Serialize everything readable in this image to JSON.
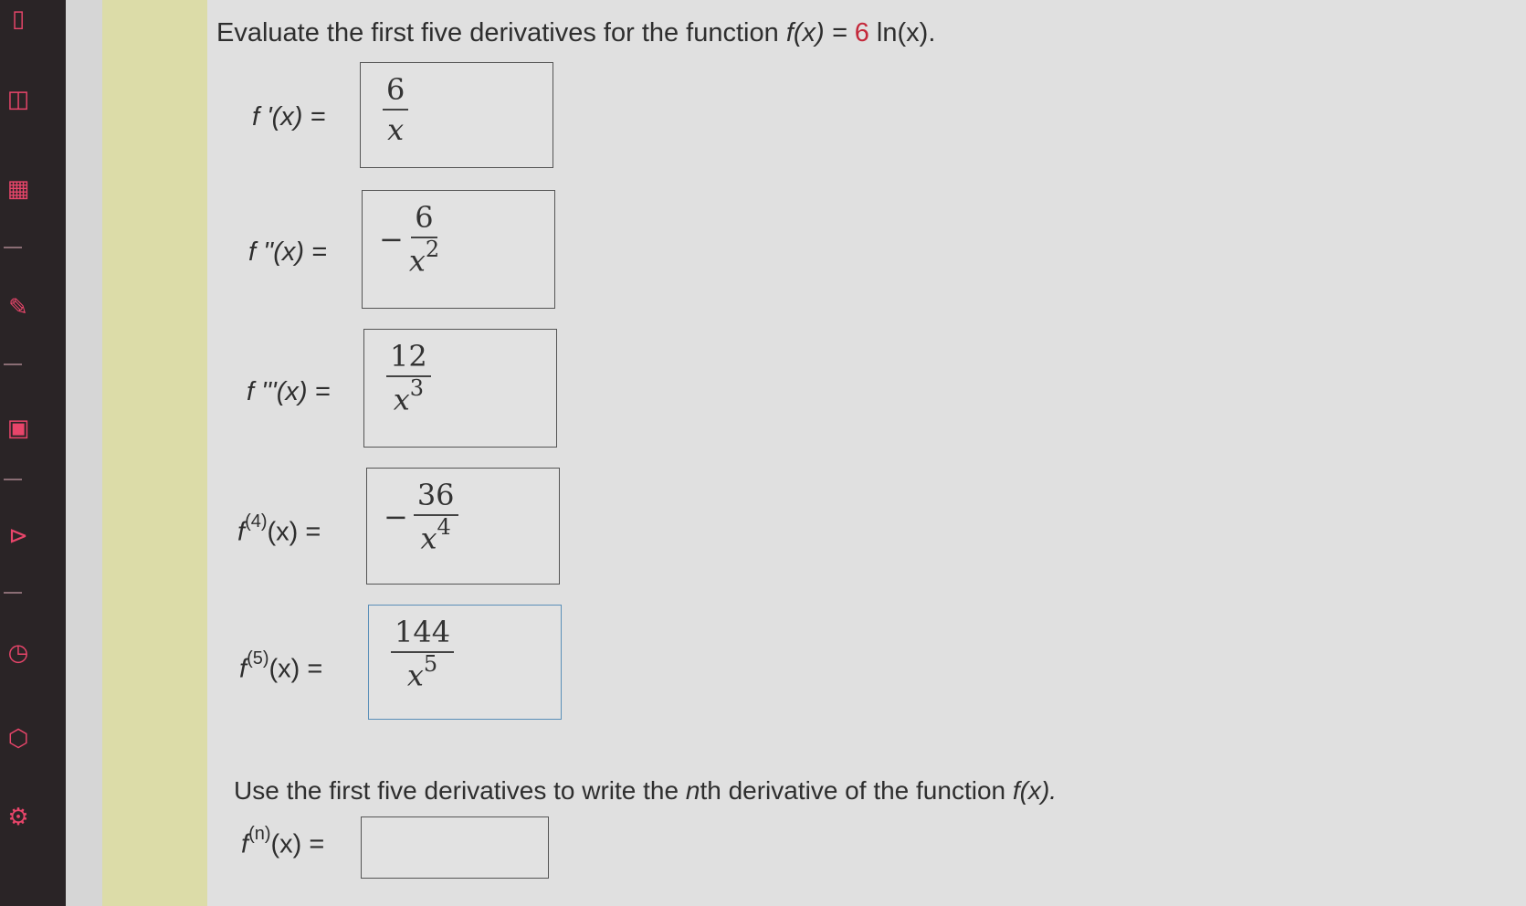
{
  "question": {
    "prefix": "Evaluate the first five derivatives for the function ",
    "function_lhs": "f(x) = ",
    "function_rhs": "6",
    "function_tail": " ln(x)."
  },
  "derivatives": [
    {
      "label": "f '(x)  =",
      "sign": "",
      "numerator": "6",
      "denominator": "x",
      "power": ""
    },
    {
      "label": "f ''(x)  =",
      "sign": "−",
      "numerator": "6",
      "denominator": "x",
      "power": "2"
    },
    {
      "label": "f '''(x)  =",
      "sign": "",
      "numerator": "12",
      "denominator": "x",
      "power": "3"
    },
    {
      "label_base": "f",
      "label_sup": "(4)",
      "label_tail": "(x)  =",
      "sign": "−",
      "numerator": "36",
      "denominator": "x",
      "power": "4"
    },
    {
      "label_base": "f",
      "label_sup": "(5)",
      "label_tail": "(x)  =",
      "sign": "",
      "numerator": "144",
      "denominator": "x",
      "power": "5"
    }
  ],
  "nth": {
    "prompt_prefix": "Use the first five derivatives to write the ",
    "prompt_n": "n",
    "prompt_mid": "th derivative of the function ",
    "prompt_fn": "f(x).",
    "label_base": "f",
    "label_sup": "(n)",
    "label_tail": "(x)  =",
    "value": ""
  },
  "sidebar": {
    "icons": [
      "document-icon",
      "bookmark-icon",
      "calculator-icon",
      "pin-icon",
      "chat-icon",
      "play-icon",
      "clock-icon",
      "cube-icon",
      "gear-icon"
    ]
  }
}
